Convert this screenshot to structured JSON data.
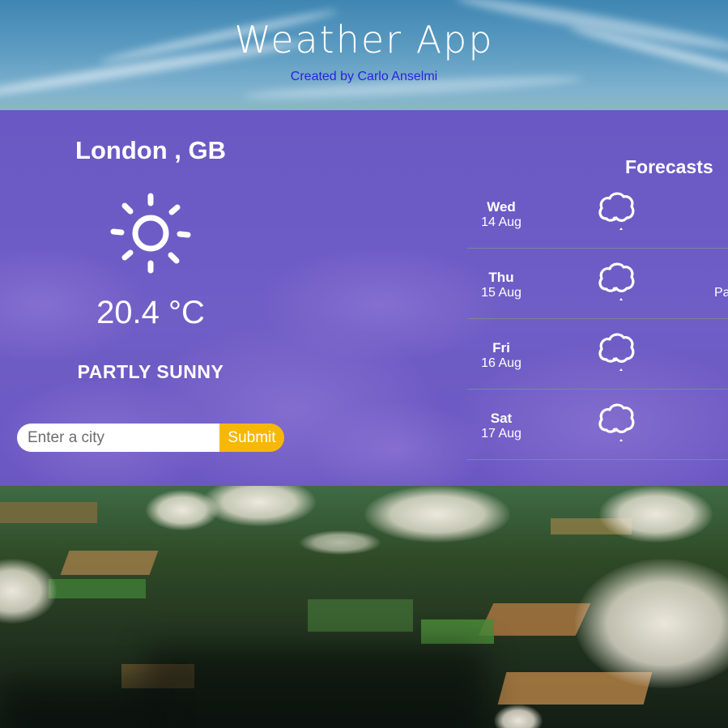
{
  "header": {
    "title": "Weather App",
    "credit": "Created by Carlo Anselmi"
  },
  "current": {
    "location": "London , GB",
    "icon": "sun-icon",
    "temperature": "20.4 °C",
    "condition": "PARTLY SUNNY"
  },
  "search": {
    "placeholder": "Enter a city",
    "value": "",
    "submit_label": "Submit"
  },
  "forecast": {
    "title": "Forecasts",
    "days": [
      {
        "day": "Wed",
        "date": "14 Aug",
        "icon": "cloud-icon",
        "condition": ""
      },
      {
        "day": "Thu",
        "date": "15 Aug",
        "icon": "cloud-icon",
        "condition": "Pa"
      },
      {
        "day": "Fri",
        "date": "16 Aug",
        "icon": "cloud-icon",
        "condition": ""
      },
      {
        "day": "Sat",
        "date": "17 Aug",
        "icon": "cloud-icon",
        "condition": ""
      }
    ]
  },
  "colors": {
    "panel": "#6a58c4",
    "accent_button": "#f7b805",
    "credit_link": "#2a1fe0",
    "text": "#ffffff"
  }
}
